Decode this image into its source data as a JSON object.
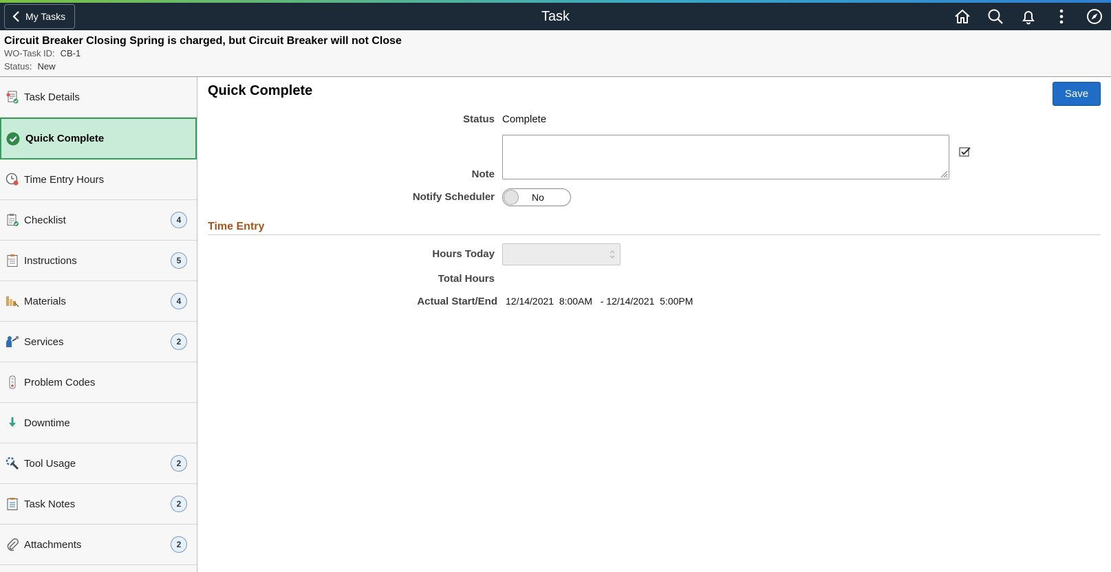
{
  "banner": {
    "back_label": "My Tasks",
    "title": "Task",
    "icons": [
      "home-icon",
      "search-icon",
      "bell-icon",
      "more-icon",
      "navigator-icon"
    ]
  },
  "header": {
    "title": "Circuit Breaker Closing Spring is charged, but Circuit Breaker will not Close",
    "wo_task_label": "WO-Task ID:",
    "wo_task_value": "CB-1",
    "status_label": "Status:",
    "status_value": "New"
  },
  "sidebar": {
    "items": [
      {
        "label": "Task Details",
        "icon": "task-details-icon",
        "count": null
      },
      {
        "label": "Quick Complete",
        "icon": "check-circle-icon",
        "count": null,
        "active": true
      },
      {
        "label": "Time Entry Hours",
        "icon": "clock-icon",
        "count": null
      },
      {
        "label": "Checklist",
        "icon": "checklist-icon",
        "count": "4"
      },
      {
        "label": "Instructions",
        "icon": "instructions-icon",
        "count": "5"
      },
      {
        "label": "Materials",
        "icon": "materials-icon",
        "count": "4"
      },
      {
        "label": "Services",
        "icon": "services-icon",
        "count": "2"
      },
      {
        "label": "Problem Codes",
        "icon": "traffic-light-icon",
        "count": null
      },
      {
        "label": "Downtime",
        "icon": "down-arrow-icon",
        "count": null
      },
      {
        "label": "Tool Usage",
        "icon": "tool-icon",
        "count": "2"
      },
      {
        "label": "Task Notes",
        "icon": "clipboard-icon",
        "count": "2"
      },
      {
        "label": "Attachments",
        "icon": "paperclip-icon",
        "count": "2"
      }
    ]
  },
  "main": {
    "title": "Quick Complete",
    "save_label": "Save",
    "status_label": "Status",
    "status_value": "Complete",
    "note_label": "Note",
    "note_value": "",
    "notify_label": "Notify Scheduler",
    "notify_value": "No",
    "time_entry_title": "Time Entry",
    "hours_today_label": "Hours Today",
    "hours_today_value": "",
    "total_hours_label": "Total Hours",
    "total_hours_value": "",
    "actual_label": "Actual Start/End",
    "actual_value": "12/14/2021  8:00AM   - 12/14/2021  5:00PM"
  },
  "colors": {
    "banner_bg": "#1c2a38",
    "active_nav_bg": "#c9ecd9",
    "active_nav_border": "#3c9a5f",
    "save_button": "#1f6dc6",
    "group_title": "#a4561c"
  }
}
